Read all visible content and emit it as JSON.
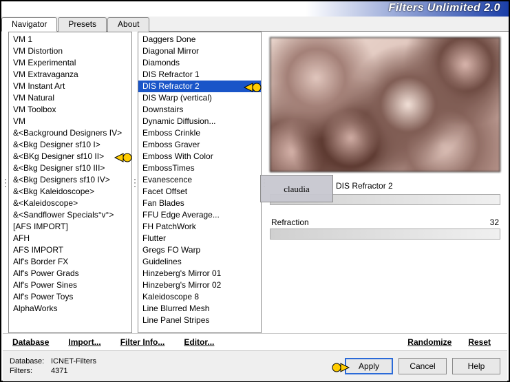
{
  "title": "Filters Unlimited 2.0",
  "tabs": [
    "Navigator",
    "Presets",
    "About"
  ],
  "active_tab": 0,
  "categories": [
    "VM 1",
    "VM Distortion",
    "VM Experimental",
    "VM Extravaganza",
    "VM Instant Art",
    "VM Natural",
    "VM Toolbox",
    "VM",
    "&<Background Designers IV>",
    "&<Bkg Designer sf10 I>",
    "&<BKg Designer sf10 II>",
    "&<Bkg Designer sf10 III>",
    "&<Bkg Designers sf10 IV>",
    "&<Bkg Kaleidoscope>",
    "&<Kaleidoscope>",
    "&<Sandflower Specials°v°>",
    "[AFS IMPORT]",
    "AFH",
    "AFS IMPORT",
    "Alf's Border FX",
    "Alf's Power Grads",
    "Alf's Power Sines",
    "Alf's Power Toys",
    "AlphaWorks"
  ],
  "filters": [
    "Daggers Done",
    "Diagonal Mirror",
    "Diamonds",
    "DIS Refractor 1",
    "DIS Refractor 2",
    "DIS Warp (vertical)",
    "Downstairs",
    "Dynamic Diffusion...",
    "Emboss Crinkle",
    "Emboss Graver",
    "Emboss With Color",
    "EmbossTimes",
    "Evanescence",
    "Facet Offset",
    "Fan Blades",
    "FFU Edge Average...",
    "FH PatchWork",
    "Flutter",
    "Gregs FO Warp",
    "Guidelines",
    "Hinzeberg's Mirror 01",
    "Hinzeberg's Mirror 02",
    "Kaleidoscope 8",
    "Line Blurred Mesh",
    "Line Panel Stripes"
  ],
  "selected_filter_index": 4,
  "pointed_category_index": 10,
  "current_filter_name": "DIS Refractor 2",
  "param_name": "Refraction",
  "param_value": "32",
  "bottom_links": {
    "database": "Database",
    "import": "Import...",
    "filter_info": "Filter Info...",
    "editor": "Editor...",
    "randomize": "Randomize",
    "reset": "Reset"
  },
  "status": {
    "db_label": "Database:",
    "db_value": "ICNET-Filters",
    "filters_label": "Filters:",
    "filters_value": "4371"
  },
  "buttons": {
    "apply": "Apply",
    "cancel": "Cancel",
    "help": "Help"
  },
  "watermark": "claudia"
}
